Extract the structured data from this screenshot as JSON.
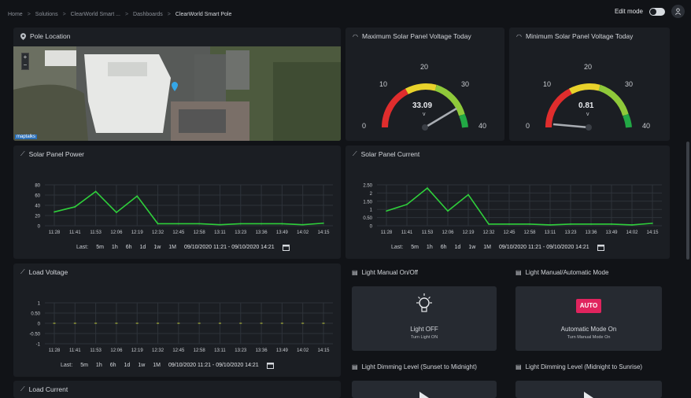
{
  "breadcrumb": [
    "Home",
    "Solutions",
    "ClearWorld Smart ...",
    "Dashboards",
    "ClearWorld Smart Pole"
  ],
  "header": {
    "edit_mode_label": "Edit mode"
  },
  "pole_location": {
    "title": "Pole Location",
    "zoom_in": "+",
    "zoom_out": "−",
    "map_logo": "maptalks"
  },
  "max_voltage": {
    "title": "Maximum Solar Panel Voltage Today",
    "value": "33.09",
    "unit": "v",
    "ticks": [
      "0",
      "10",
      "20",
      "30",
      "40"
    ],
    "min": 0,
    "max": 40
  },
  "min_voltage": {
    "title": "Minimum Solar Panel Voltage Today",
    "value": "0.81",
    "unit": "v",
    "ticks": [
      "0",
      "10",
      "20",
      "30",
      "40"
    ],
    "min": 0,
    "max": 40
  },
  "time_labels": [
    "11:28",
    "11:41",
    "11:53",
    "12:06",
    "12:19",
    "12:32",
    "12:45",
    "12:58",
    "13:11",
    "13:23",
    "13:36",
    "13:49",
    "14:02",
    "14:15"
  ],
  "range_bar": {
    "last_label": "Last:",
    "options": [
      "5m",
      "1h",
      "6h",
      "1d",
      "1w",
      "1M"
    ],
    "dates": "09/10/2020 11:21 - 09/10/2020 14:21"
  },
  "chart_data": [
    {
      "type": "line",
      "title": "Solar Panel Power",
      "x": [
        "11:28",
        "11:41",
        "11:53",
        "12:06",
        "12:19",
        "12:32",
        "12:45",
        "12:58",
        "13:11",
        "13:23",
        "13:36",
        "13:49",
        "14:02",
        "14:15"
      ],
      "series": [
        {
          "values": [
            27,
            37,
            67,
            26,
            58,
            4,
            4,
            4,
            2,
            4,
            4,
            4,
            2,
            5
          ]
        }
      ],
      "yticks": [
        "80",
        "60",
        "40",
        "20",
        "0"
      ],
      "ylim": [
        0,
        80
      ],
      "color": "#2fcf3b",
      "grid": true
    },
    {
      "type": "line",
      "title": "Solar Panel Current",
      "x": [
        "11:28",
        "11:41",
        "11:53",
        "12:06",
        "12:19",
        "12:32",
        "12:45",
        "12:58",
        "13:11",
        "13:23",
        "13:36",
        "13:49",
        "14:02",
        "14:15"
      ],
      "series": [
        {
          "values": [
            0.9,
            1.3,
            2.3,
            0.9,
            1.9,
            0.1,
            0.1,
            0.1,
            0.05,
            0.1,
            0.1,
            0.1,
            0.05,
            0.15
          ]
        }
      ],
      "yticks": [
        "2.50",
        "2",
        "1.50",
        "1",
        "0.50",
        "0"
      ],
      "ylim": [
        0,
        2.5
      ],
      "color": "#2fcf3b",
      "grid": true
    },
    {
      "type": "scatter",
      "title": "Load Voltage",
      "x": [
        "11:28",
        "11:41",
        "11:53",
        "12:06",
        "12:19",
        "12:32",
        "12:45",
        "12:58",
        "13:11",
        "13:23",
        "13:36",
        "13:49",
        "14:02",
        "14:15"
      ],
      "series": [
        {
          "values": [
            0,
            0,
            0,
            0,
            0,
            0,
            0,
            0,
            0,
            0,
            0,
            0,
            0,
            0
          ]
        }
      ],
      "yticks": [
        "1",
        "0.50",
        "0",
        "-0.50",
        "-1"
      ],
      "ylim": [
        -1,
        1
      ],
      "color": "#a9b23a",
      "grid": true
    }
  ],
  "light_manual": {
    "title": "Light Manual On/Off",
    "status": "Light OFF",
    "action": "Turn Light ON"
  },
  "light_mode": {
    "title": "Light Manual/Automatic Mode",
    "badge": "AUTO",
    "status": "Automatic Mode On",
    "action": "Turn Manual Mode On",
    "badge_color": "#e0245e"
  },
  "dimming_sunset": {
    "title": "Light Dimming Level (Sunset to Midnight)"
  },
  "dimming_midnight": {
    "title": "Light Dimming Level (Midnight to Sunrise)"
  },
  "load_current": {
    "title": "Load Current"
  }
}
